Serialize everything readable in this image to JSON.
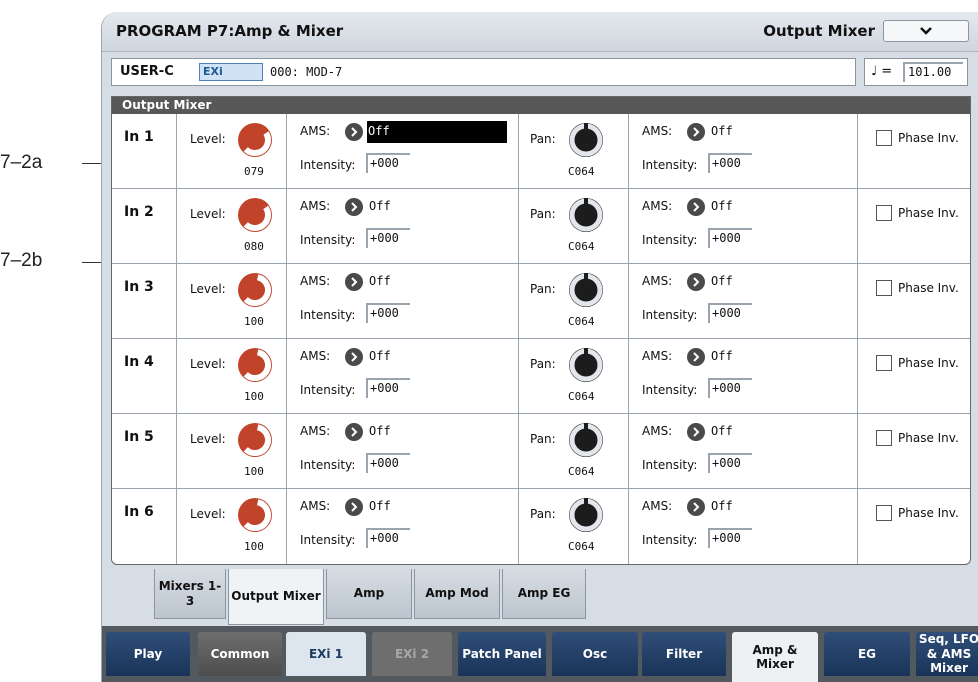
{
  "callouts": [
    "7–2a",
    "7–2b"
  ],
  "header": {
    "title": "PROGRAM P7:Amp & Mixer",
    "page_menu_label": "Output Mixer"
  },
  "program": {
    "bank": "USER-C",
    "bank_type": "EXi",
    "name": "000: MOD-7",
    "tempo_label": "♩ =",
    "tempo": "101.00"
  },
  "mixer": {
    "section_title": "Output Mixer",
    "labels": {
      "level": "Level:",
      "ams": "AMS:",
      "intensity": "Intensity:",
      "pan": "Pan:",
      "phase_inv": "Phase Inv."
    },
    "rows": [
      {
        "in": "In 1",
        "level": "079",
        "level_pct": 0.62,
        "ams": "Off",
        "ams_selected": true,
        "intensity": "+000",
        "pan": "C064",
        "pan_ams": "Off",
        "pan_intensity": "+000",
        "phase_inv": false
      },
      {
        "in": "In 2",
        "level": "080",
        "level_pct": 0.63,
        "ams": "Off",
        "ams_selected": false,
        "intensity": "+000",
        "pan": "C064",
        "pan_ams": "Off",
        "pan_intensity": "+000",
        "phase_inv": false
      },
      {
        "in": "In 3",
        "level": "100",
        "level_pct": 0.79,
        "ams": "Off",
        "ams_selected": false,
        "intensity": "+000",
        "pan": "C064",
        "pan_ams": "Off",
        "pan_intensity": "+000",
        "phase_inv": false
      },
      {
        "in": "In 4",
        "level": "100",
        "level_pct": 0.79,
        "ams": "Off",
        "ams_selected": false,
        "intensity": "+000",
        "pan": "C064",
        "pan_ams": "Off",
        "pan_intensity": "+000",
        "phase_inv": false
      },
      {
        "in": "In 5",
        "level": "100",
        "level_pct": 0.79,
        "ams": "Off",
        "ams_selected": false,
        "intensity": "+000",
        "pan": "C064",
        "pan_ams": "Off",
        "pan_intensity": "+000",
        "phase_inv": false
      },
      {
        "in": "In 6",
        "level": "100",
        "level_pct": 0.79,
        "ams": "Off",
        "ams_selected": false,
        "intensity": "+000",
        "pan": "C064",
        "pan_ams": "Off",
        "pan_intensity": "+000",
        "phase_inv": false
      }
    ]
  },
  "sub_tabs": [
    "Mixers 1-3",
    "Output Mixer",
    "Amp",
    "Amp Mod",
    "Amp EG"
  ],
  "active_sub_tab": "Output Mixer",
  "main_tabs": [
    "Play",
    "Common",
    "EXi 1",
    "EXi 2",
    "Patch Panel",
    "Osc",
    "Filter",
    "Amp & Mixer",
    "EG",
    "Seq, LFO & AMS Mixer"
  ],
  "active_main_tab": "Amp & Mixer",
  "colors": {
    "level_knob": "#c0432a",
    "pan_knob": "#e3e6ea",
    "tab_blue": "#1f3d66"
  }
}
